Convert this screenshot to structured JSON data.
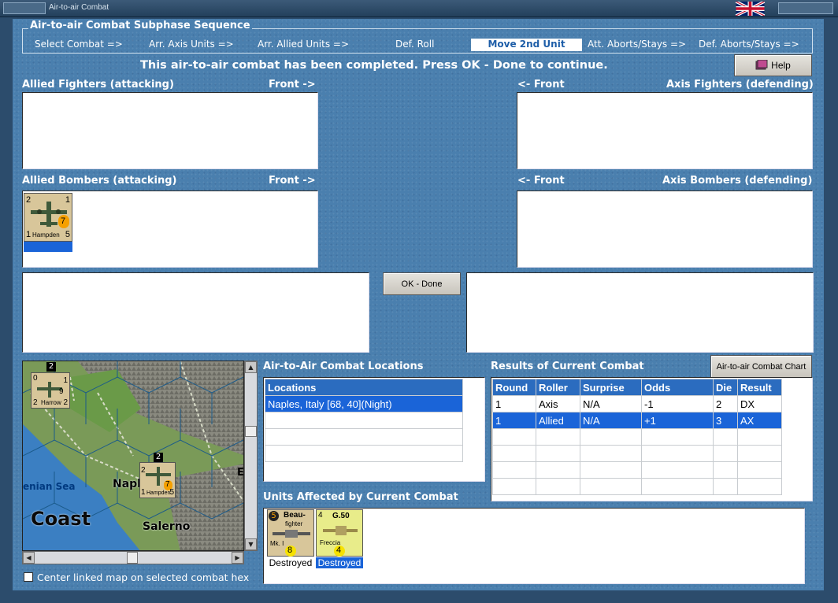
{
  "window": {
    "title": "Air-to-air Combat"
  },
  "sequence": {
    "title": "Air-to-air Combat Subphase Sequence",
    "steps": [
      "Select Combat =>",
      "Arr. Axis Units =>",
      "Arr. Allied Units =>",
      "Def. Roll",
      "Move 2nd Unit",
      "Att. Aborts/Stays =>",
      "Def. Aborts/Stays =>"
    ]
  },
  "message": "This air-to-air combat has been completed.  Press OK - Done to continue.",
  "buttons": {
    "help": "Help",
    "ok_done": "OK - Done",
    "combat_chart": "Air-to-air Combat Chart"
  },
  "labels": {
    "allied_fighters": "Allied Fighters (attacking)",
    "front_right": "Front ->",
    "front_left": "<- Front",
    "axis_fighters": "Axis Fighters (defending)",
    "allied_bombers": "Allied Bombers (attacking)",
    "axis_bombers": "Axis Bombers (defending)",
    "locations_title": "Air-to-Air Combat Locations",
    "results_title": "Results of Current Combat",
    "units_affected": "Units Affected by Current Combat",
    "center_map": "Center linked map on selected combat hex"
  },
  "allied_bomber_unit": {
    "name": "Hampden",
    "top_left": "2",
    "top_right": "1",
    "bottom_left": "1",
    "bottom_right": "5",
    "badge": "7"
  },
  "locations": {
    "header": "Locations",
    "rows": [
      "Naples, Italy [68, 40](Night)"
    ]
  },
  "results": {
    "headers": [
      "Round",
      "Roller",
      "Surprise",
      "Odds",
      "Die",
      "Result"
    ],
    "rows": [
      [
        "1",
        "Axis",
        "N/A",
        "-1",
        "2",
        "DX"
      ],
      [
        "1",
        "Allied",
        "N/A",
        "+1",
        "3",
        "AX"
      ]
    ]
  },
  "affected_units": [
    {
      "name": "Beau-fighter",
      "line1": "Beau-",
      "line2": "fighter",
      "mark": "Mk. I",
      "top_left": "5",
      "badge": "8",
      "status": "Destroyed"
    },
    {
      "name": "G.50",
      "line1": "G.50",
      "line2": "Freccia",
      "top_left": "4",
      "badge": "4",
      "status": "Destroyed"
    }
  ],
  "map": {
    "labels": {
      "sea": "enian Sea",
      "coast": "Coast",
      "naples": "Napl",
      "salerno": "Salerno",
      "edge": "E"
    },
    "harrow": {
      "name": "Harrow",
      "top_left": "0",
      "stack": "2",
      "right_top": "1",
      "bottom_left": "2",
      "bottom_right": "2",
      "badge": "9"
    },
    "hampden": {
      "name": "Hampden",
      "stack": "2",
      "left_top": "2",
      "bottom_left": "1",
      "bottom_right": "5",
      "badge": "7"
    }
  },
  "colors": {
    "water": "#4a7fae",
    "selection": "#1a64d8",
    "header": "#2b6cbf",
    "active_step": "#1e5ea8"
  }
}
